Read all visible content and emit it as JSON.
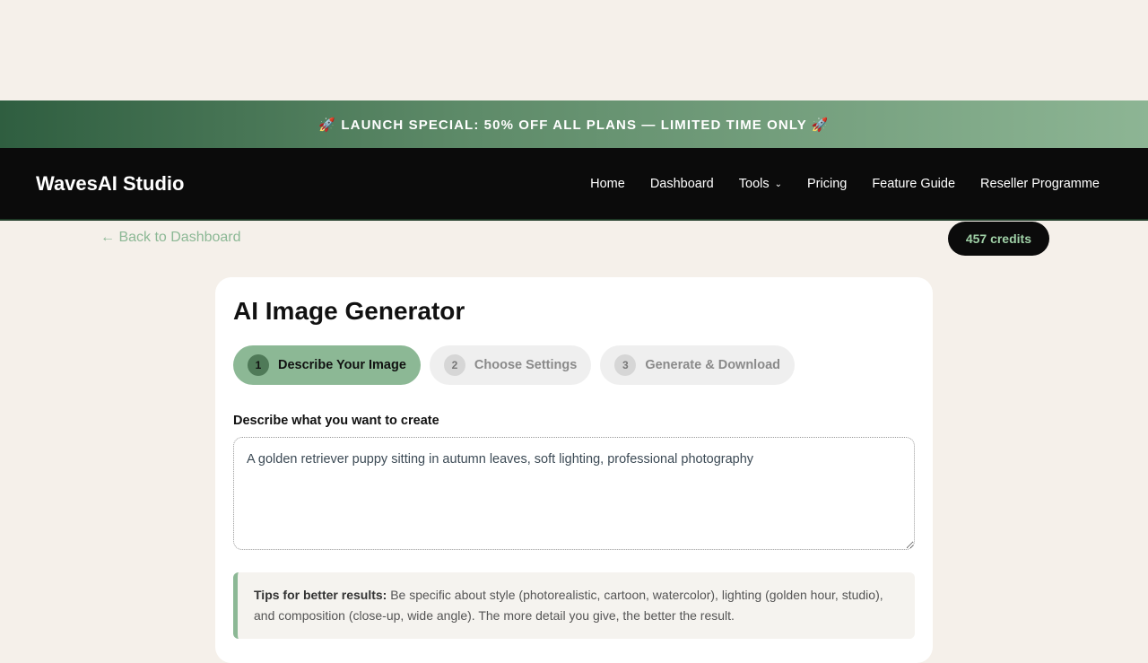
{
  "promo": {
    "text": "🚀 LAUNCH SPECIAL: 50% OFF ALL PLANS — LIMITED TIME ONLY 🚀"
  },
  "navbar": {
    "brand": "WavesAI Studio",
    "links": [
      "Home",
      "Dashboard",
      "Tools",
      "Pricing",
      "Feature Guide",
      "Reseller Programme"
    ],
    "dropdown_icon": "chevron-down-icon"
  },
  "subbar": {
    "back_label": "← Back to Dashboard",
    "credits_label": "457 credits"
  },
  "card": {
    "title": "AI Image Generator",
    "steps": [
      {
        "num": "1",
        "label": "Describe Your Image"
      },
      {
        "num": "2",
        "label": "Choose Settings"
      },
      {
        "num": "3",
        "label": "Generate & Download"
      }
    ],
    "prompt_label": "Describe what you want to create",
    "prompt_value": "A golden retriever puppy sitting in autumn leaves, soft lighting, professional photography",
    "tips_title": "Tips for better results:",
    "tips_text": " Be specific about style (photorealistic, cartoon, watercolor), lighting (golden hour, studio), and composition (close-up, wide angle). The more detail you give, the better the result."
  },
  "colors": {
    "accent": "#8cb895",
    "nav_bg": "#0b0b0b",
    "page_bg": "#f5f0ea"
  }
}
